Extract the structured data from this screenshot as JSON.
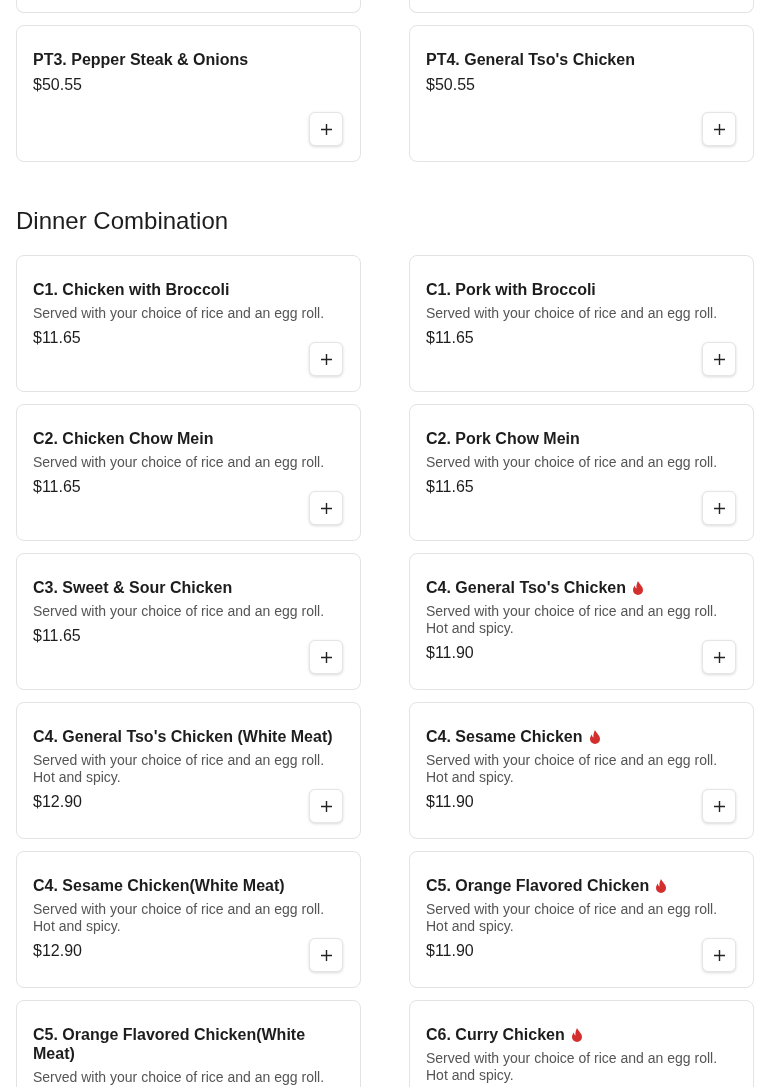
{
  "party_trays": [
    {
      "name": "PT3. Pepper Steak & Onions",
      "price": "$50.55",
      "spicy": false
    },
    {
      "name": "PT4. General Tso's Chicken",
      "price": "$50.55",
      "spicy": false
    }
  ],
  "section_title": "Dinner Combination",
  "items": [
    {
      "name": "C1. Chicken with Broccoli",
      "description": "Served with your choice of rice and an egg roll.",
      "price": "$11.65",
      "spicy": false
    },
    {
      "name": "C1. Pork with Broccoli",
      "description": "Served with your choice of rice and an egg roll.",
      "price": "$11.65",
      "spicy": false
    },
    {
      "name": "C2. Chicken Chow Mein",
      "description": "Served with your choice of rice and an egg roll.",
      "price": "$11.65",
      "spicy": false
    },
    {
      "name": "C2. Pork Chow Mein",
      "description": "Served with your choice of rice and an egg roll.",
      "price": "$11.65",
      "spicy": false
    },
    {
      "name": "C3. Sweet & Sour Chicken",
      "description": "Served with your choice of rice and an egg roll.",
      "price": "$11.65",
      "spicy": false
    },
    {
      "name": "C4. General Tso's Chicken",
      "description": "Served with your choice of rice and an egg roll. Hot and spicy.",
      "price": "$11.90",
      "spicy": true
    },
    {
      "name": "C4. General Tso's Chicken (White Meat)",
      "description": "Served with your choice of rice and an egg roll. Hot and spicy.",
      "price": "$12.90",
      "spicy": false
    },
    {
      "name": "C4. Sesame Chicken",
      "description": "Served with your choice of rice and an egg roll. Hot and spicy.",
      "price": "$11.90",
      "spicy": true
    },
    {
      "name": "C4. Sesame Chicken(White Meat)",
      "description": "Served with your choice of rice and an egg roll. Hot and spicy.",
      "price": "$12.90",
      "spicy": false
    },
    {
      "name": "C5. Orange Flavored Chicken",
      "description": "Served with your choice of rice and an egg roll. Hot and spicy.",
      "price": "$11.90",
      "spicy": true
    },
    {
      "name": "C5. Orange Flavored Chicken(White Meat)",
      "description": "Served with your choice of rice and an egg roll.",
      "spicy": false
    },
    {
      "name": "C6. Curry Chicken",
      "description": "Served with your choice of rice and an egg roll. Hot and spicy.",
      "spicy": true
    }
  ]
}
